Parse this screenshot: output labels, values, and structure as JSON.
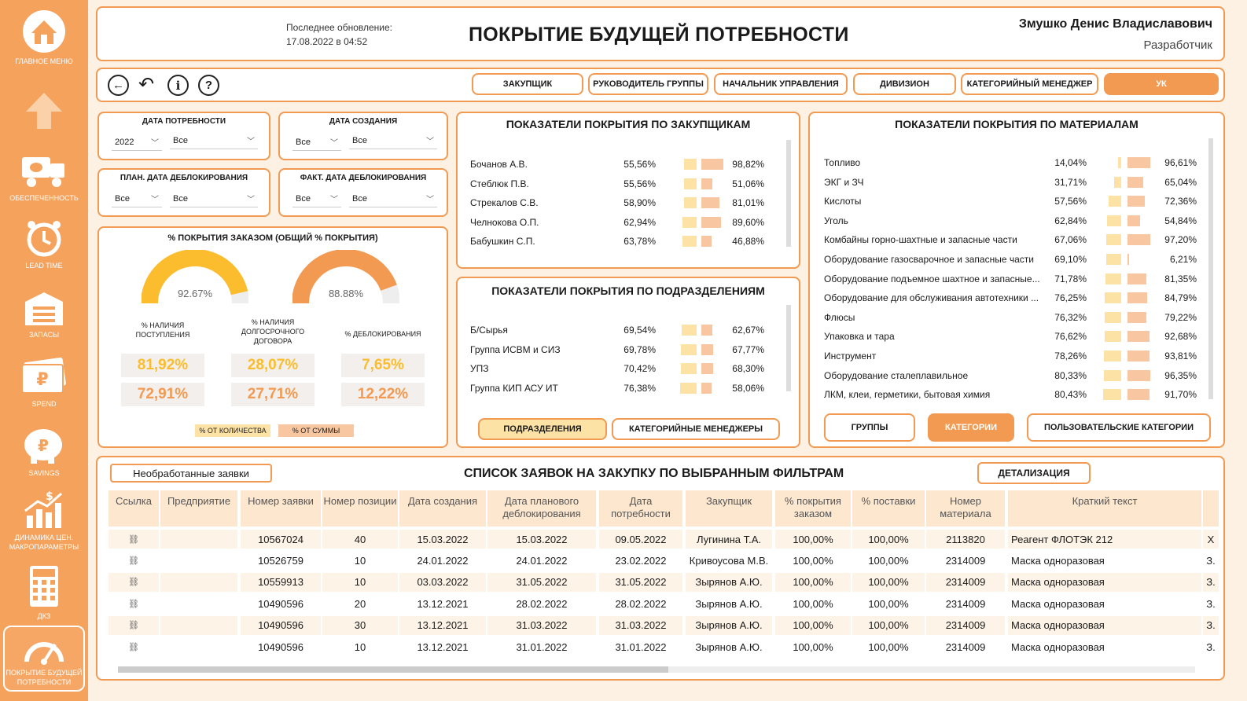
{
  "sidebar": {
    "items": [
      {
        "label": "ГЛАВНОЕ МЕНЮ",
        "icon": "home-icon"
      },
      {
        "label": "",
        "icon": "arrow-up-icon"
      },
      {
        "label": "ОБЕСПЕЧЕННОСТЬ",
        "icon": "truck-icon"
      },
      {
        "label": "LEAD TIME",
        "icon": "alarm-clock-icon"
      },
      {
        "label": "ЗАПАСЫ",
        "icon": "warehouse-icon"
      },
      {
        "label": "SPEND",
        "icon": "money-icon"
      },
      {
        "label": "SAVINGS",
        "icon": "piggy-bank-icon"
      },
      {
        "label": "ДИНАМИКА ЦЕН. МАКРОПАРАМЕТРЫ",
        "icon": "chart-up-icon"
      },
      {
        "label": "ДКЗ",
        "icon": "calculator-icon"
      },
      {
        "label": "ПОКРЫТИЕ БУДУЩЕЙ ПОТРЕБНОСТИ",
        "icon": "gauge-icon"
      }
    ]
  },
  "header": {
    "update_label": "Последнее обновление:",
    "update_value": "17.08.2022 в 04:52",
    "title": "ПОКРЫТИЕ БУДУЩЕЙ ПОТРЕБНОСТИ",
    "user": "Змушко Денис Владиславович",
    "role": "Разработчик"
  },
  "roles": [
    "ЗАКУПЩИК",
    "РУКОВОДИТЕЛЬ ГРУППЫ",
    "НАЧАЛЬНИК УПРАВЛЕНИЯ",
    "ДИВИЗИОН",
    "КАТЕГОРИЙНЫЙ МЕНЕДЖЕР",
    "УК"
  ],
  "filters": {
    "need_date": {
      "title": "ДАТА ПОТРЕБНОСТИ",
      "v1": "2022",
      "v2": "Все"
    },
    "create_date": {
      "title": "ДАТА СОЗДАНИЯ",
      "v1": "Все",
      "v2": "Все"
    },
    "plan_unblock": {
      "title": "ПЛАН. ДАТА ДЕБЛОКИРОВАНИЯ",
      "v1": "Все",
      "v2": "Все"
    },
    "fact_unblock": {
      "title": "ФАКТ. ДАТА ДЕБЛОКИРОВАНИЯ",
      "v1": "Все",
      "v2": "Все"
    }
  },
  "coverage": {
    "title": "% ПОКРЫТИЯ ЗАКАЗОМ (ОБЩИЙ % ПОКРЫТИЯ)",
    "gauge1": {
      "value": 92.67,
      "label": "92.67%",
      "color": "#fbbd2e"
    },
    "gauge2": {
      "value": 88.88,
      "label": "88.88%",
      "color": "#f29a52"
    },
    "labels": [
      "% НАЛИЧИЯ ПОСТУПЛЕНИЯ",
      "% НАЛИЧИЯ ДОЛГОСРОЧНОГО ДОГОВОРА",
      "% ДЕБЛОКИРОВАНИЯ"
    ],
    "kpi_qty": [
      "81,92%",
      "28,07%",
      "7,65%"
    ],
    "kpi_sum": [
      "72,91%",
      "27,71%",
      "12,22%"
    ],
    "legend_qty": "% ОТ КОЛИЧЕСТВА",
    "legend_sum": "% ОТ СУММЫ"
  },
  "buyers": {
    "title": "ПОКАЗАТЕЛИ ПОКРЫТИЯ ПО ЗАКУПЩИКАМ",
    "rows": [
      {
        "name": "Бочанов А.В.",
        "a": "55,56%",
        "b": "98,82%",
        "av": 55.56,
        "bv": 98.82
      },
      {
        "name": "Стеблюк П.В.",
        "a": "55,56%",
        "b": "51,06%",
        "av": 55.56,
        "bv": 51.06
      },
      {
        "name": "Стрекалов С.В.",
        "a": "58,90%",
        "b": "81,01%",
        "av": 58.9,
        "bv": 81.01
      },
      {
        "name": "Челнокова О.П.",
        "a": "62,94%",
        "b": "89,60%",
        "av": 62.94,
        "bv": 89.6
      },
      {
        "name": "Бабушкин С.П.",
        "a": "63,78%",
        "b": "46,88%",
        "av": 63.78,
        "bv": 46.88
      }
    ]
  },
  "divisions": {
    "title": "ПОКАЗАТЕЛИ ПОКРЫТИЯ ПО ПОДРАЗДЕЛЕНИЯМ",
    "rows": [
      {
        "name": "Б/Сырья",
        "a": "69,54%",
        "b": "62,67%",
        "av": 69.54,
        "bv": 62.67
      },
      {
        "name": "Группа ИСВМ и СИЗ",
        "a": "69,78%",
        "b": "67,77%",
        "av": 69.78,
        "bv": 67.77
      },
      {
        "name": "УПЗ",
        "a": "70,42%",
        "b": "68,30%",
        "av": 70.42,
        "bv": 68.3
      },
      {
        "name": "Группа КИП АСУ ИТ",
        "a": "76,38%",
        "b": "58,06%",
        "av": 76.38,
        "bv": 58.06
      }
    ],
    "btn1": "ПОДРАЗДЕЛЕНИЯ",
    "btn2": "КАТЕГОРИЙНЫЕ МЕНЕДЖЕРЫ"
  },
  "materials": {
    "title": "ПОКАЗАТЕЛИ ПОКРЫТИЯ ПО МАТЕРИАЛАМ",
    "rows": [
      {
        "name": "Топливо",
        "a": "14,04%",
        "b": "96,61%",
        "av": 14.04,
        "bv": 96.61
      },
      {
        "name": "ЭКГ и ЗЧ",
        "a": "31,71%",
        "b": "65,04%",
        "av": 31.71,
        "bv": 65.04
      },
      {
        "name": "Кислоты",
        "a": "57,56%",
        "b": "72,36%",
        "av": 57.56,
        "bv": 72.36
      },
      {
        "name": "Уголь",
        "a": "62,84%",
        "b": "54,84%",
        "av": 62.84,
        "bv": 54.84
      },
      {
        "name": "Комбайны горно-шахтные и запасные части",
        "a": "67,06%",
        "b": "97,20%",
        "av": 67.06,
        "bv": 97.2
      },
      {
        "name": "Оборудование газосварочное и запасные части",
        "a": "69,10%",
        "b": "6,21%",
        "av": 69.1,
        "bv": 6.21
      },
      {
        "name": "Оборудование подъемное шахтное и запасные...",
        "a": "71,78%",
        "b": "81,35%",
        "av": 71.78,
        "bv": 81.35
      },
      {
        "name": "Оборудование для обслуживания автотехники ...",
        "a": "76,25%",
        "b": "84,79%",
        "av": 76.25,
        "bv": 84.79
      },
      {
        "name": "Флюсы",
        "a": "76,32%",
        "b": "79,22%",
        "av": 76.32,
        "bv": 79.22
      },
      {
        "name": "Упаковка и тара",
        "a": "76,62%",
        "b": "92,68%",
        "av": 76.62,
        "bv": 92.68
      },
      {
        "name": "Инструмент",
        "a": "78,26%",
        "b": "93,81%",
        "av": 78.26,
        "bv": 93.81
      },
      {
        "name": "Оборудование сталеплавильное",
        "a": "80,33%",
        "b": "96,35%",
        "av": 80.33,
        "bv": 96.35
      },
      {
        "name": "ЛКМ, клеи, герметики, бытовая химия",
        "a": "80,43%",
        "b": "91,70%",
        "av": 80.43,
        "bv": 91.7
      }
    ],
    "btn1": "ГРУППЫ",
    "btn2": "КАТЕГОРИИ",
    "btn3": "ПОЛЬЗОВАТЕЛЬСКИЕ КАТЕГОРИИ"
  },
  "orders": {
    "unprocessed": "Необработанные заявки",
    "title": "СПИСОК ЗАЯВОК НА ЗАКУПКУ ПО ВЫБРАННЫМ ФИЛЬТРАМ",
    "detail": "ДЕТАЛИЗАЦИЯ",
    "columns": [
      "Ссылка",
      "Предприятие",
      "Номер заявки",
      "Номер позиции",
      "Дата создания",
      "Дата планового деблокирования",
      "Дата потребности",
      "Закупщик",
      "% покрытия заказом",
      "% поставки",
      "Номер материала",
      "Краткий текст"
    ],
    "rows": [
      [
        "",
        "",
        "10567024",
        "40",
        "15.03.2022",
        "15.03.2022",
        "09.05.2022",
        "Лугинина Т.А.",
        "100,00%",
        "100,00%",
        "2113820",
        "Реагент ФЛОТЭК 212",
        "Х"
      ],
      [
        "",
        "",
        "10526759",
        "10",
        "24.01.2022",
        "24.01.2022",
        "23.02.2022",
        "Кривоусова М.В.",
        "100,00%",
        "100,00%",
        "2314009",
        "Маска одноразовая",
        "З."
      ],
      [
        "",
        "",
        "10559913",
        "10",
        "03.03.2022",
        "31.05.2022",
        "31.05.2022",
        "Зырянов А.Ю.",
        "100,00%",
        "100,00%",
        "2314009",
        "Маска одноразовая",
        "З."
      ],
      [
        "",
        "",
        "10490596",
        "20",
        "13.12.2021",
        "28.02.2022",
        "28.02.2022",
        "Зырянов А.Ю.",
        "100,00%",
        "100,00%",
        "2314009",
        "Маска одноразовая",
        "З."
      ],
      [
        "",
        "",
        "10490596",
        "30",
        "13.12.2021",
        "31.03.2022",
        "31.03.2022",
        "Зырянов А.Ю.",
        "100,00%",
        "100,00%",
        "2314009",
        "Маска одноразовая",
        "З."
      ],
      [
        "",
        "",
        "10490596",
        "10",
        "13.12.2021",
        "31.01.2022",
        "31.01.2022",
        "Зырянов А.Ю.",
        "100,00%",
        "100,00%",
        "2314009",
        "Маска одноразовая",
        "З."
      ]
    ]
  }
}
